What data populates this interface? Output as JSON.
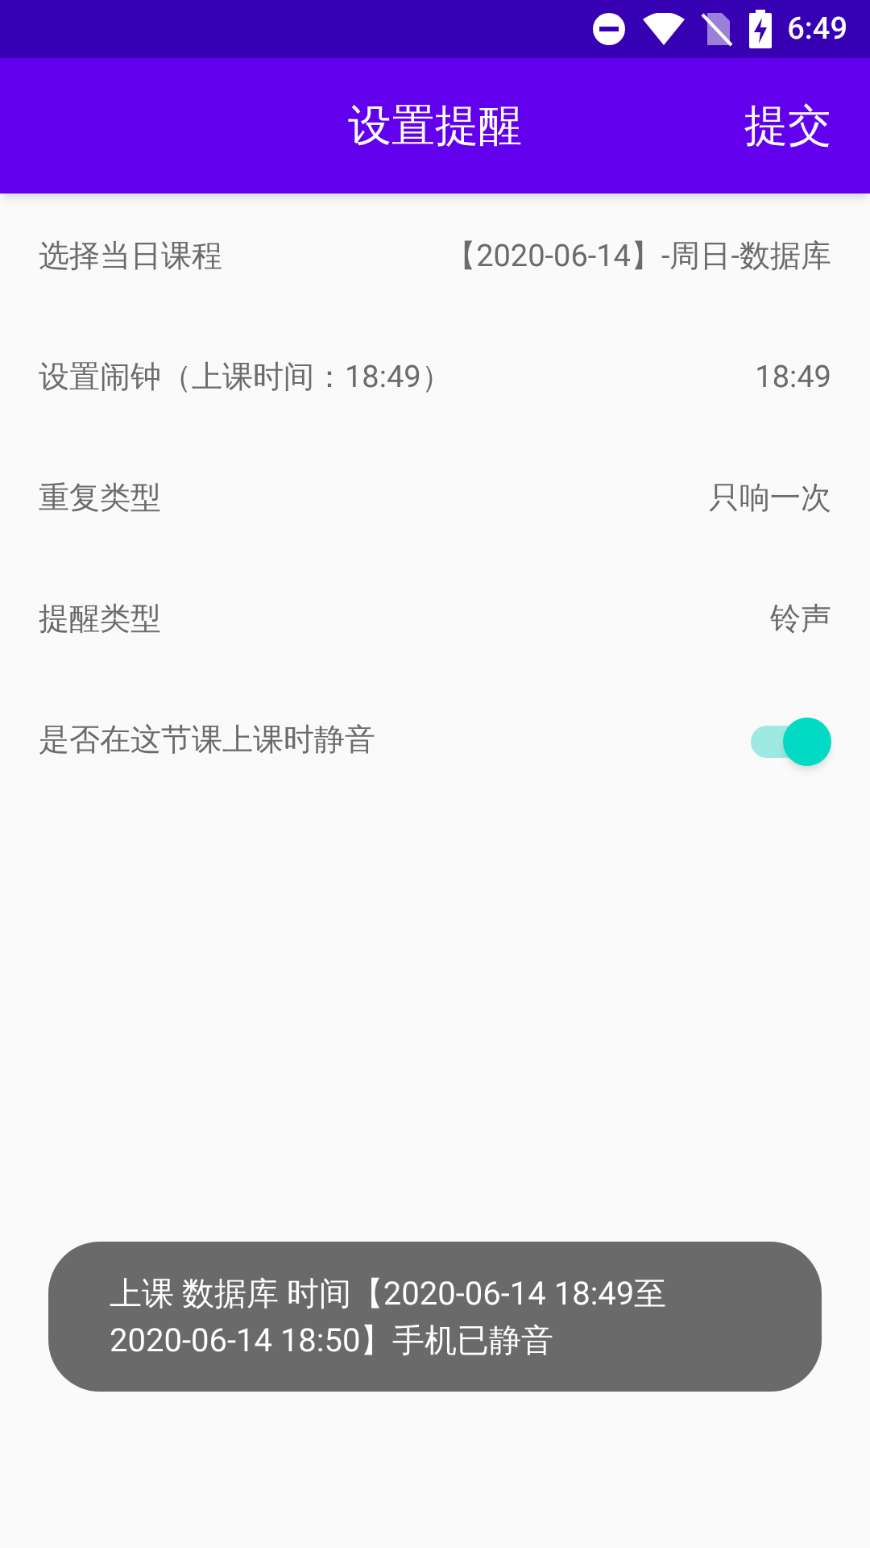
{
  "status_bar": {
    "time": "6:49"
  },
  "app_bar": {
    "title": "设置提醒",
    "action": "提交"
  },
  "settings": [
    {
      "kind": "value",
      "label": "选择当日课程",
      "value": "【2020-06-14】-周日-数据库"
    },
    {
      "kind": "value",
      "label": "设置闹钟（上课时间：18:49）",
      "value": "18:49"
    },
    {
      "kind": "value",
      "label": "重复类型",
      "value": "只响一次"
    },
    {
      "kind": "value",
      "label": "提醒类型",
      "value": "铃声"
    },
    {
      "kind": "switch",
      "label": "是否在这节课上课时静音",
      "on": true
    }
  ],
  "toast": {
    "text": "上课 数据库 时间【2020-06-14 18:49至 2020-06-14 18:50】手机已静音"
  }
}
